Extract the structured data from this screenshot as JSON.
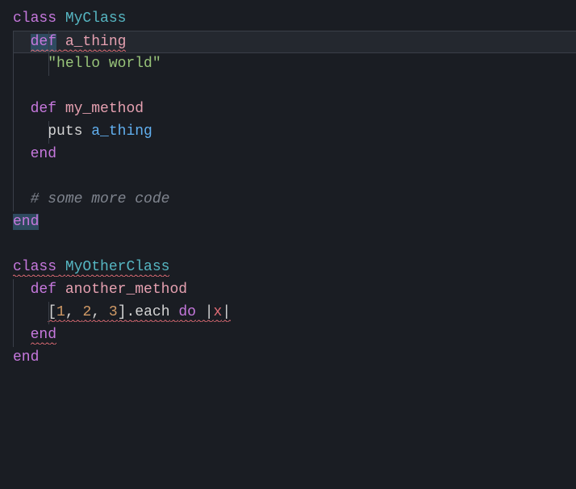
{
  "code": {
    "l1": {
      "kw": "class",
      "name": "MyClass"
    },
    "l2": {
      "kw": "def",
      "name": "a_thing"
    },
    "l3": {
      "str": "\"hello world\""
    },
    "l4": {
      "kw": "def",
      "name": "my_method"
    },
    "l5": {
      "builtin": "puts",
      "call": "a_thing"
    },
    "l6": {
      "kw": "end"
    },
    "l7": {
      "comment": "# some more code"
    },
    "l8": {
      "kw": "end"
    },
    "l9": {
      "kw": "class",
      "name": "MyOtherClass"
    },
    "l10": {
      "kw": "def",
      "name": "another_method"
    },
    "l11": {
      "b1": "[",
      "n1": "1",
      "c1": ", ",
      "n2": "2",
      "c2": ", ",
      "n3": "3",
      "b2": "].",
      "each": "each",
      "do": "do",
      "p1": " |",
      "x": "x",
      "p2": "|"
    },
    "l12": {
      "kw": "end"
    },
    "l13": {
      "kw": "end"
    }
  }
}
